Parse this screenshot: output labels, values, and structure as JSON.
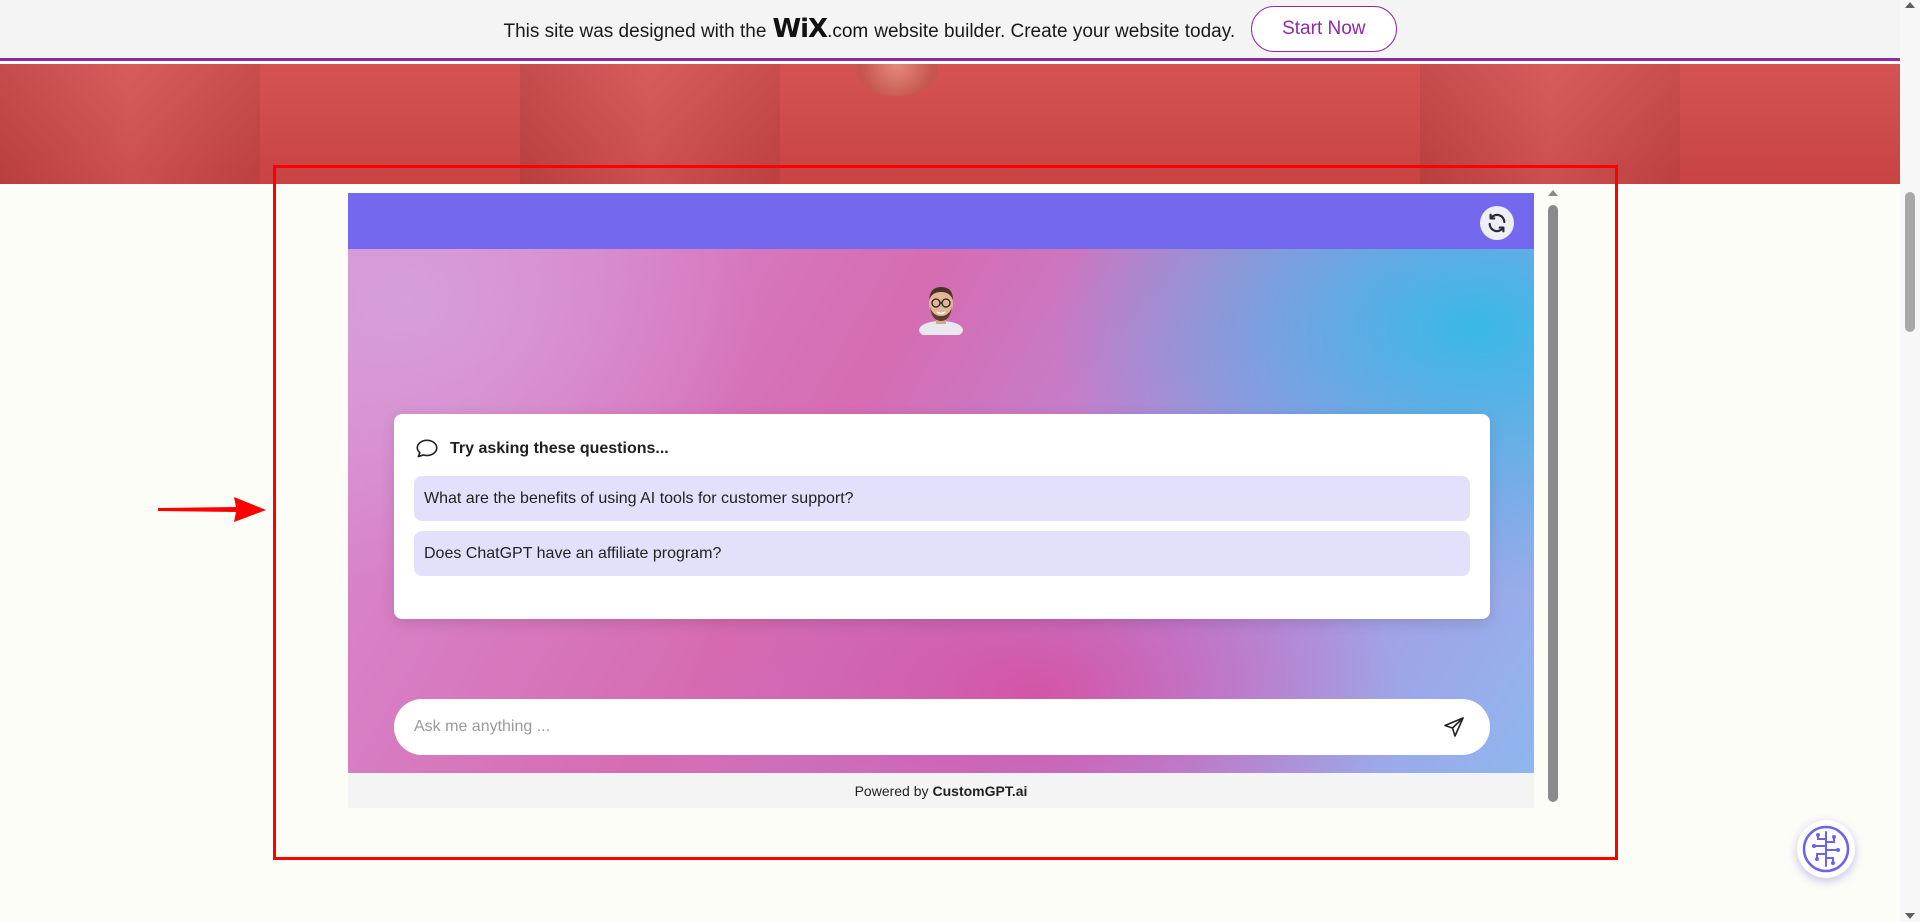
{
  "banner": {
    "text_before": "This site was designed with the",
    "logo": "WiX",
    "logo_suffix": ".com",
    "text_after": "website builder. Create your website today.",
    "cta_label": "Start Now",
    "accent_color": "#8e2aa8"
  },
  "chat": {
    "header_color": "#7468ee",
    "refresh_icon": "refresh-icon",
    "avatar_icon": "avatar-icon",
    "suggestions": {
      "title": "Try asking these questions...",
      "icon": "chat-bubble-icon",
      "items": [
        "What are the benefits of using AI tools for customer support?",
        "Does ChatGPT have an affiliate program?"
      ]
    },
    "input": {
      "placeholder": "Ask me anything ...",
      "value": ""
    },
    "send_icon": "send-icon",
    "footer": {
      "prefix": "Powered by",
      "brand": "CustomGPT.ai"
    }
  },
  "fab_icon": "ai-brain-icon"
}
